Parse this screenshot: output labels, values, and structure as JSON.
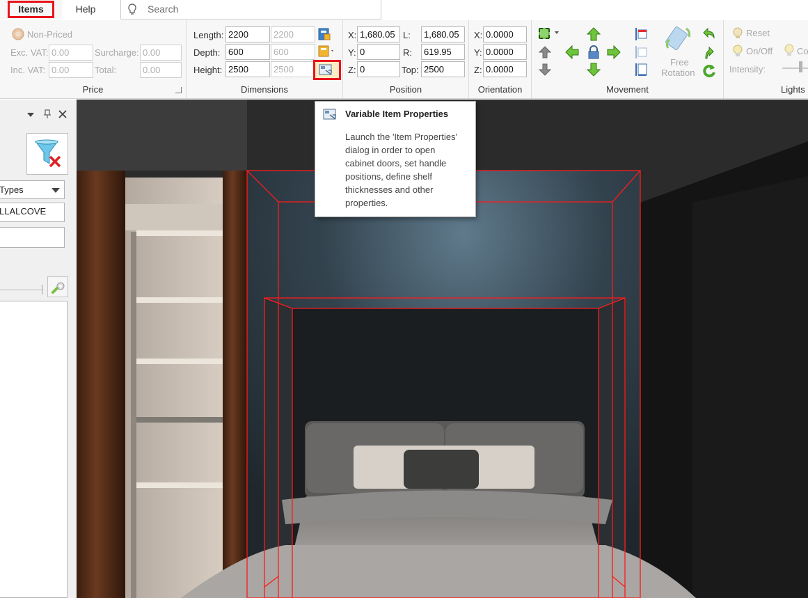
{
  "tabs": {
    "items": "Items",
    "help": "Help"
  },
  "search": {
    "placeholder": "Search"
  },
  "price": {
    "title": "Price",
    "non_priced": "Non-Priced",
    "exc_vat_label": "Exc. VAT:",
    "exc_vat_value": "0.00",
    "inc_vat_label": "Inc. VAT:",
    "inc_vat_value": "0.00",
    "surcharge_label": "Surcharge:",
    "surcharge_value": "0.00",
    "total_label": "Total:",
    "total_value": "0.00"
  },
  "dimensions": {
    "title": "Dimensions",
    "length_label": "Length:",
    "length_value": "2200",
    "length_default": "2200",
    "depth_label": "Depth:",
    "depth_value": "600",
    "depth_default": "600",
    "height_label": "Height:",
    "height_value": "2500",
    "height_default": "2500"
  },
  "position": {
    "title": "Position",
    "x_label": "X:",
    "x_value": "1,680.05",
    "y_label": "Y:",
    "y_value": "0",
    "z_label": "Z:",
    "z_value": "0",
    "l_label": "L:",
    "l_value": "1,680.05",
    "r_label": "R:",
    "r_value": "619.95",
    "top_label": "Top:",
    "top_value": "2500"
  },
  "orientation": {
    "title": "Orientation",
    "x_label": "X:",
    "x_value": "0.0000",
    "y_label": "Y:",
    "y_value": "0.0000",
    "z_label": "Z:",
    "z_value": "0.0000"
  },
  "movement": {
    "title": "Movement",
    "free_rotation_line1": "Free",
    "free_rotation_line2": "Rotation"
  },
  "lights": {
    "title": "Lights",
    "reset": "Reset",
    "on_off": "On/Off",
    "color": "Co",
    "intensity_label": "Intensity:"
  },
  "left_panel": {
    "types_value": "Types",
    "field1_value": "LLALCOVE",
    "field2_value": ""
  },
  "tooltip": {
    "title": "Variable Item Properties",
    "lines": [
      "Launch the 'Item Properties'",
      "dialog in order to open",
      "cabinet doors, set handle",
      "positions,  define shelf",
      "thicknesses and other",
      "properties."
    ]
  },
  "colors": {
    "accent_highlight": "#e8141b",
    "arrow_green": "#4aa82a",
    "ribbon_bg": "#f7f7f7",
    "wireframe": "#ff1a1a"
  }
}
